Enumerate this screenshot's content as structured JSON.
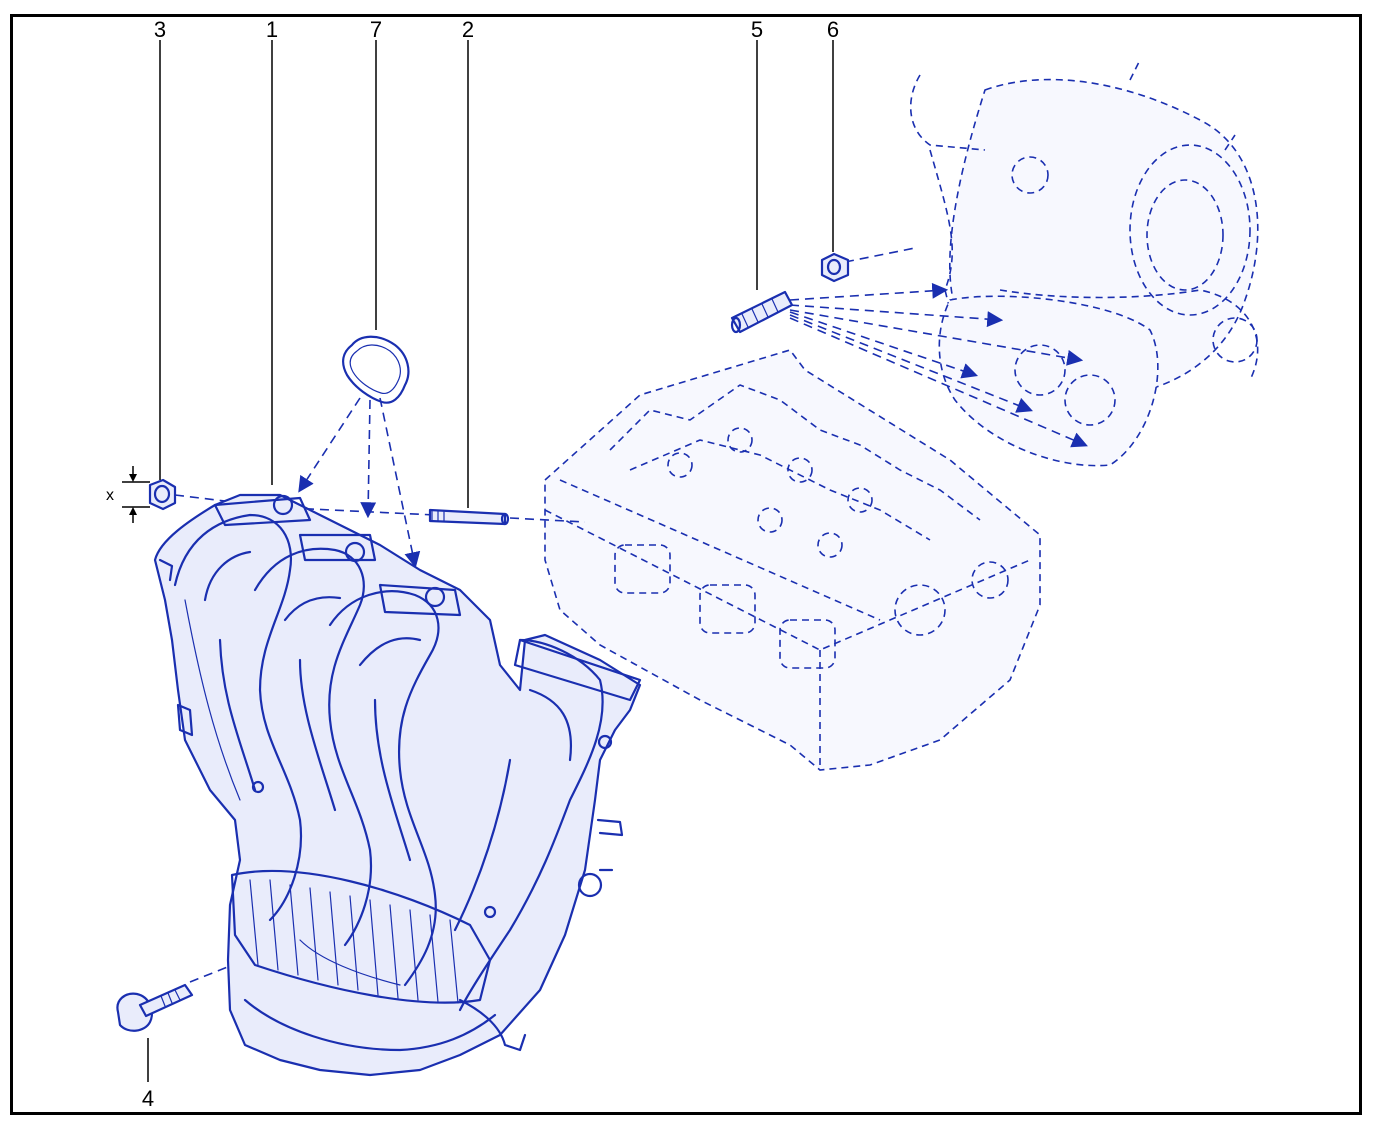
{
  "callouts": {
    "c1": "1",
    "c2": "2",
    "c3": "3",
    "c4": "4",
    "c5": "5",
    "c6": "6",
    "c7": "7"
  },
  "dimension_label": "x",
  "colors": {
    "line_art": "#1a2fb0",
    "frame": "#000000",
    "background": "#ffffff"
  }
}
